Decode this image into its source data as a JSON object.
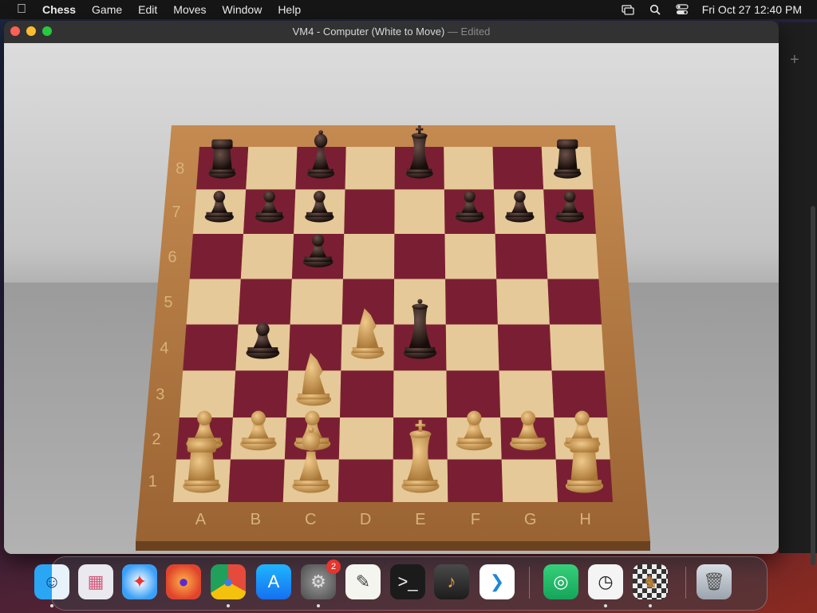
{
  "menubar": {
    "app_name": "Chess",
    "items": [
      "Game",
      "Edit",
      "Moves",
      "Window",
      "Help"
    ],
    "clock": "Fri Oct 27  12:40 PM"
  },
  "window": {
    "title": "VM4 - Computer   (White to Move)",
    "title_separator": "—",
    "title_status": "Edited"
  },
  "board": {
    "files": [
      "A",
      "B",
      "C",
      "D",
      "E",
      "F",
      "G",
      "H"
    ],
    "ranks": [
      "1",
      "2",
      "3",
      "4",
      "5",
      "6",
      "7",
      "8"
    ],
    "pieces": [
      {
        "square": "a8",
        "color": "black",
        "type": "rook"
      },
      {
        "square": "c8",
        "color": "black",
        "type": "bishop"
      },
      {
        "square": "e8",
        "color": "black",
        "type": "king"
      },
      {
        "square": "h8",
        "color": "black",
        "type": "rook"
      },
      {
        "square": "a7",
        "color": "black",
        "type": "pawn"
      },
      {
        "square": "b7",
        "color": "black",
        "type": "pawn"
      },
      {
        "square": "c7",
        "color": "black",
        "type": "pawn"
      },
      {
        "square": "f7",
        "color": "black",
        "type": "pawn"
      },
      {
        "square": "g7",
        "color": "black",
        "type": "pawn"
      },
      {
        "square": "h7",
        "color": "black",
        "type": "pawn"
      },
      {
        "square": "c6",
        "color": "black",
        "type": "pawn"
      },
      {
        "square": "b4",
        "color": "black",
        "type": "pawn"
      },
      {
        "square": "e4",
        "color": "black",
        "type": "queen"
      },
      {
        "square": "d4",
        "color": "white",
        "type": "knight"
      },
      {
        "square": "c3",
        "color": "white",
        "type": "knight"
      },
      {
        "square": "a2",
        "color": "white",
        "type": "pawn"
      },
      {
        "square": "b2",
        "color": "white",
        "type": "pawn"
      },
      {
        "square": "c2",
        "color": "white",
        "type": "pawn"
      },
      {
        "square": "f2",
        "color": "white",
        "type": "pawn"
      },
      {
        "square": "g2",
        "color": "white",
        "type": "pawn"
      },
      {
        "square": "h2",
        "color": "white",
        "type": "pawn"
      },
      {
        "square": "a1",
        "color": "white",
        "type": "rook"
      },
      {
        "square": "c1",
        "color": "white",
        "type": "bishop"
      },
      {
        "square": "e1",
        "color": "white",
        "type": "king"
      },
      {
        "square": "h1",
        "color": "white",
        "type": "rook"
      }
    ],
    "colors": {
      "light_square": "#e6c998",
      "dark_square": "#7a1f33",
      "frame": "#b0753d",
      "black_piece": "#2a1a16",
      "white_piece": "#d6a866"
    }
  },
  "dock": {
    "apps": [
      {
        "name": "Finder",
        "icon": "finder-icon",
        "running": true
      },
      {
        "name": "Launchpad",
        "icon": "launchpad-icon",
        "running": false
      },
      {
        "name": "Safari",
        "icon": "safari-icon",
        "running": false
      },
      {
        "name": "Firefox",
        "icon": "firefox-icon",
        "running": false
      },
      {
        "name": "Chrome",
        "icon": "chrome-icon",
        "running": true
      },
      {
        "name": "App Store",
        "icon": "app-store-icon",
        "running": false
      },
      {
        "name": "System Settings",
        "icon": "settings-icon",
        "running": true,
        "badge": "2"
      },
      {
        "name": "TextEdit",
        "icon": "textedit-icon",
        "running": false
      },
      {
        "name": "Terminal",
        "icon": "terminal-icon",
        "running": false
      },
      {
        "name": "GarageBand",
        "icon": "garageband-icon",
        "running": false
      },
      {
        "name": "VS Code",
        "icon": "vscode-icon",
        "running": false
      },
      {
        "name": "Find My",
        "icon": "findmy-icon",
        "running": false
      },
      {
        "name": "Clock",
        "icon": "clock-icon",
        "running": true
      },
      {
        "name": "Chess",
        "icon": "chess-icon",
        "running": true
      },
      {
        "name": "Trash",
        "icon": "trash-icon",
        "running": false
      }
    ]
  }
}
